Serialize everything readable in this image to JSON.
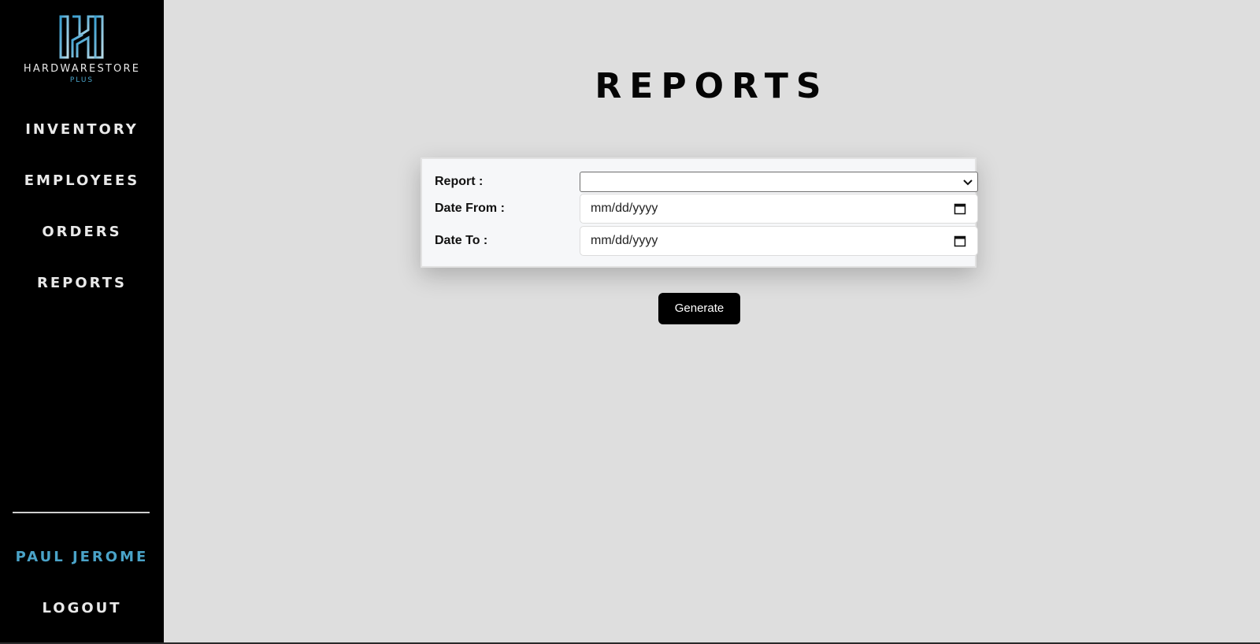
{
  "colors": {
    "sidebar_bg": "#000000",
    "content_bg": "#dedede",
    "accent": "#4aa3c8",
    "button_bg": "#000000"
  },
  "brand": {
    "name": "HARDWARESTORE",
    "sub": "PLUS",
    "logo_icon": "logo-h-icon"
  },
  "sidebar": {
    "items": [
      {
        "label": "INVENTORY"
      },
      {
        "label": "EMPLOYEES"
      },
      {
        "label": "ORDERS"
      },
      {
        "label": "REPORTS"
      }
    ],
    "user": "PAUL JEROME",
    "logout": "LOGOUT"
  },
  "page": {
    "title": "REPORTS"
  },
  "form": {
    "report_label": "Report :",
    "report_value": "",
    "date_from_label": "Date From :",
    "date_from_placeholder": "mm/dd/yyyy",
    "date_to_label": "Date To :",
    "date_to_placeholder": "mm/dd/yyyy"
  },
  "actions": {
    "generate_label": "Generate"
  }
}
